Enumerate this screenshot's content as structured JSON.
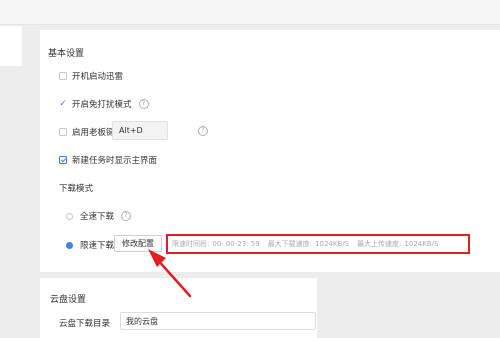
{
  "sections": {
    "basic": "基本设置",
    "download_mode": "下载模式",
    "cloud": "云盘设置"
  },
  "basic": {
    "startup": "开机启动迅雷",
    "dnd": "开启免打扰模式",
    "boss_key": "启用老板键",
    "boss_key_value": "Alt+D",
    "show_main": "新建任务时显示主界面"
  },
  "download_mode": {
    "full_speed": "全速下载",
    "limited": "限速下载",
    "modify_button": "修改配置",
    "limit_time_label": "限速时间段:",
    "limit_time_value": "00: 00-23: 59",
    "max_download_label": "最大下载速度:",
    "max_download_value": "1024KB/S",
    "max_upload_label": "最大上传速度:",
    "max_upload_value": "1024KB/S",
    "selected": "limited"
  },
  "cloud": {
    "download_dir_label": "云盘下载目录",
    "download_dir_value": "我的云盘"
  },
  "colors": {
    "accent": "#3b82f6",
    "highlight": "#e02020"
  },
  "icons": {
    "help": "question-circle-icon",
    "arrow": "red-arrow-annotation"
  }
}
